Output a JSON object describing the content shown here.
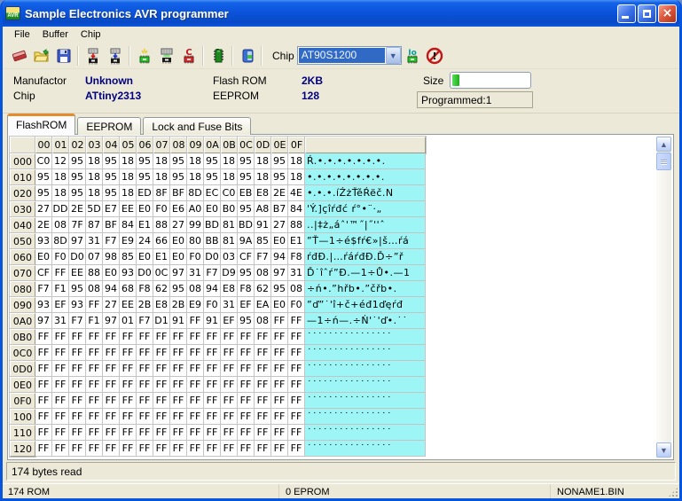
{
  "window": {
    "title": "Sample Electronics AVR programmer"
  },
  "menu": {
    "items": [
      {
        "label": "File"
      },
      {
        "label": "Buffer"
      },
      {
        "label": "Chip"
      }
    ]
  },
  "toolbar": {
    "chip_label": "Chip",
    "chip_selected": "AT90S1200",
    "icons": [
      "erase-buffer",
      "open-file",
      "save-file",
      "program-chip",
      "read-chip",
      "erase-chip",
      "verify-chip",
      "lock-chip",
      "chip-info",
      "exit",
      "io-config",
      "cancel"
    ]
  },
  "info": {
    "manufactor_label": "Manufactor",
    "manufactor_value": "Unknown",
    "chip_label": "Chip",
    "chip_value": "ATtiny2313",
    "flash_label": "Flash ROM",
    "flash_value": "2KB",
    "eeprom_label": "EEPROM",
    "eeprom_value": "128",
    "size_label": "Size",
    "progress_fraction": 0.09,
    "programmed_text": "Programmed:1"
  },
  "tabs": [
    {
      "label": "FlashROM",
      "active": true
    },
    {
      "label": "EEPROM",
      "active": false
    },
    {
      "label": "Lock and Fuse Bits",
      "active": false
    }
  ],
  "table": {
    "col_headers": [
      "00",
      "01",
      "02",
      "03",
      "04",
      "05",
      "06",
      "07",
      "08",
      "09",
      "0A",
      "0B",
      "0C",
      "0D",
      "0E",
      "0F"
    ],
    "rows": [
      {
        "addr": "000",
        "bytes": [
          "C0",
          "12",
          "95",
          "18",
          "95",
          "18",
          "95",
          "18",
          "95",
          "18",
          "95",
          "18",
          "95",
          "18",
          "95",
          "18"
        ],
        "ascii": "Ŕ.•.•.•.•.•.•.•."
      },
      {
        "addr": "010",
        "bytes": [
          "95",
          "18",
          "95",
          "18",
          "95",
          "18",
          "95",
          "18",
          "95",
          "18",
          "95",
          "18",
          "95",
          "18",
          "95",
          "18"
        ],
        "ascii": "•.•.•.•.•.•.•.•."
      },
      {
        "addr": "020",
        "bytes": [
          "95",
          "18",
          "95",
          "18",
          "95",
          "18",
          "ED",
          "8F",
          "BF",
          "8D",
          "EC",
          "C0",
          "EB",
          "E8",
          "2E",
          "4E"
        ],
        "ascii": "•.•.•.íŹżŤěŔëč.N"
      },
      {
        "addr": "030",
        "bytes": [
          "27",
          "DD",
          "2E",
          "5D",
          "E7",
          "EE",
          "E0",
          "F0",
          "E6",
          "A0",
          "E0",
          "B0",
          "95",
          "A8",
          "B7",
          "84"
        ],
        "ascii": "'Ý.]çîŕđć ŕ°•¨·„"
      },
      {
        "addr": "040",
        "bytes": [
          "2E",
          "08",
          "7F",
          "87",
          "BF",
          "84",
          "E1",
          "88",
          "27",
          "99",
          "BD",
          "81",
          "BD",
          "91",
          "27",
          "88"
        ],
        "ascii": "..|‡ż„áˆ'™˝|˝''ˆ"
      },
      {
        "addr": "050",
        "bytes": [
          "93",
          "8D",
          "97",
          "31",
          "F7",
          "E9",
          "24",
          "66",
          "E0",
          "80",
          "BB",
          "81",
          "9A",
          "85",
          "E0",
          "E1"
        ],
        "ascii": "”Ť—1÷é$fŕ€»|š…ŕá"
      },
      {
        "addr": "060",
        "bytes": [
          "E0",
          "F0",
          "D0",
          "07",
          "98",
          "85",
          "E0",
          "E1",
          "E0",
          "F0",
          "D0",
          "03",
          "CF",
          "F7",
          "94",
          "F8"
        ],
        "ascii": "ŕđĐ.|…ŕáŕđĐ.Ď÷”ř"
      },
      {
        "addr": "070",
        "bytes": [
          "CF",
          "FF",
          "EE",
          "88",
          "E0",
          "93",
          "D0",
          "0C",
          "97",
          "31",
          "F7",
          "D9",
          "95",
          "08",
          "97",
          "31"
        ],
        "ascii": "Ď˙îˆŕ”Đ.—1÷Ů•.—1"
      },
      {
        "addr": "080",
        "bytes": [
          "F7",
          "F1",
          "95",
          "08",
          "94",
          "68",
          "F8",
          "62",
          "95",
          "08",
          "94",
          "E8",
          "F8",
          "62",
          "95",
          "08"
        ],
        "ascii": "÷ń•.”hřb•.”čřb•."
      },
      {
        "addr": "090",
        "bytes": [
          "93",
          "EF",
          "93",
          "FF",
          "27",
          "EE",
          "2B",
          "E8",
          "2B",
          "E9",
          "F0",
          "31",
          "EF",
          "EA",
          "E0",
          "F0"
        ],
        "ascii": "”ď”˙'î+č+éđ1ďęŕđ"
      },
      {
        "addr": "0A0",
        "bytes": [
          "97",
          "31",
          "F7",
          "F1",
          "97",
          "01",
          "F7",
          "D1",
          "91",
          "FF",
          "91",
          "EF",
          "95",
          "08",
          "FF",
          "FF"
        ],
        "ascii": "—1÷ń—.÷Ń'˙'ď•.˙˙"
      },
      {
        "addr": "0B0",
        "bytes": [
          "FF",
          "FF",
          "FF",
          "FF",
          "FF",
          "FF",
          "FF",
          "FF",
          "FF",
          "FF",
          "FF",
          "FF",
          "FF",
          "FF",
          "FF",
          "FF"
        ],
        "ascii": "˙˙˙˙˙˙˙˙˙˙˙˙˙˙˙˙"
      },
      {
        "addr": "0C0",
        "bytes": [
          "FF",
          "FF",
          "FF",
          "FF",
          "FF",
          "FF",
          "FF",
          "FF",
          "FF",
          "FF",
          "FF",
          "FF",
          "FF",
          "FF",
          "FF",
          "FF"
        ],
        "ascii": "˙˙˙˙˙˙˙˙˙˙˙˙˙˙˙˙"
      },
      {
        "addr": "0D0",
        "bytes": [
          "FF",
          "FF",
          "FF",
          "FF",
          "FF",
          "FF",
          "FF",
          "FF",
          "FF",
          "FF",
          "FF",
          "FF",
          "FF",
          "FF",
          "FF",
          "FF"
        ],
        "ascii": "˙˙˙˙˙˙˙˙˙˙˙˙˙˙˙˙"
      },
      {
        "addr": "0E0",
        "bytes": [
          "FF",
          "FF",
          "FF",
          "FF",
          "FF",
          "FF",
          "FF",
          "FF",
          "FF",
          "FF",
          "FF",
          "FF",
          "FF",
          "FF",
          "FF",
          "FF"
        ],
        "ascii": "˙˙˙˙˙˙˙˙˙˙˙˙˙˙˙˙"
      },
      {
        "addr": "0F0",
        "bytes": [
          "FF",
          "FF",
          "FF",
          "FF",
          "FF",
          "FF",
          "FF",
          "FF",
          "FF",
          "FF",
          "FF",
          "FF",
          "FF",
          "FF",
          "FF",
          "FF"
        ],
        "ascii": "˙˙˙˙˙˙˙˙˙˙˙˙˙˙˙˙"
      },
      {
        "addr": "100",
        "bytes": [
          "FF",
          "FF",
          "FF",
          "FF",
          "FF",
          "FF",
          "FF",
          "FF",
          "FF",
          "FF",
          "FF",
          "FF",
          "FF",
          "FF",
          "FF",
          "FF"
        ],
        "ascii": "˙˙˙˙˙˙˙˙˙˙˙˙˙˙˙˙"
      },
      {
        "addr": "110",
        "bytes": [
          "FF",
          "FF",
          "FF",
          "FF",
          "FF",
          "FF",
          "FF",
          "FF",
          "FF",
          "FF",
          "FF",
          "FF",
          "FF",
          "FF",
          "FF",
          "FF"
        ],
        "ascii": "˙˙˙˙˙˙˙˙˙˙˙˙˙˙˙˙"
      },
      {
        "addr": "120",
        "bytes": [
          "FF",
          "FF",
          "FF",
          "FF",
          "FF",
          "FF",
          "FF",
          "FF",
          "FF",
          "FF",
          "FF",
          "FF",
          "FF",
          "FF",
          "FF",
          "FF"
        ],
        "ascii": "˙˙˙˙˙˙˙˙˙˙˙˙˙˙˙˙"
      }
    ]
  },
  "message": "174 bytes read",
  "statusbar": {
    "panels": [
      "174 ROM",
      "0 EPROM",
      "NONAME1.BIN"
    ]
  }
}
